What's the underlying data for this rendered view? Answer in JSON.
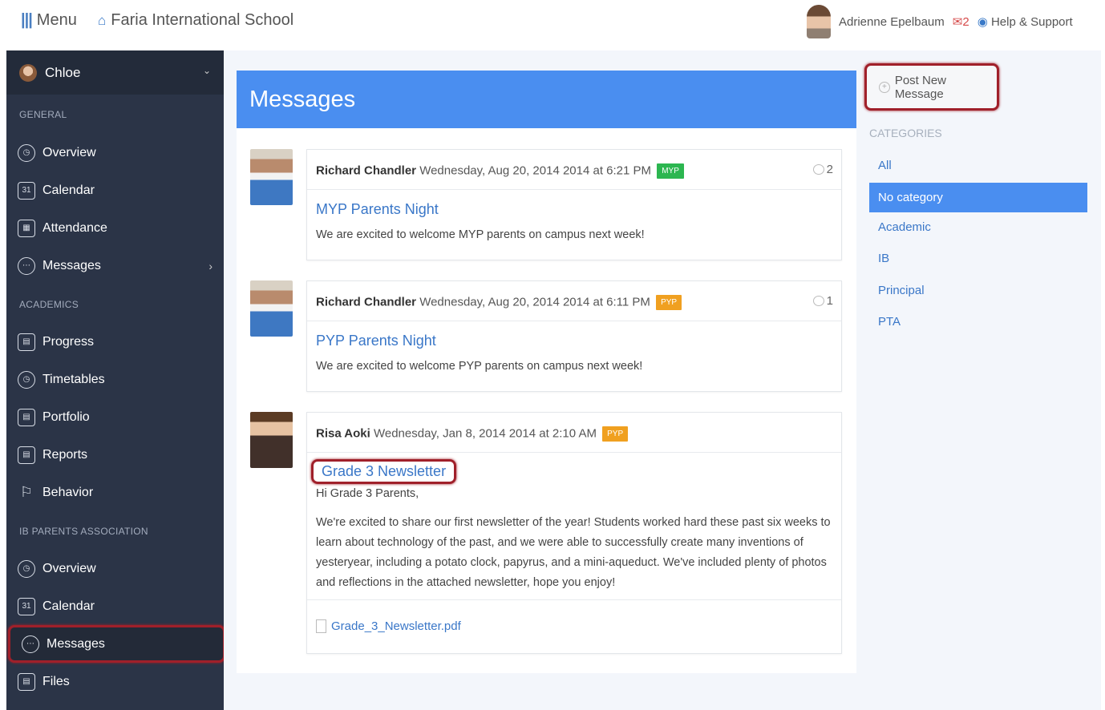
{
  "topbar": {
    "menu_label": "Menu",
    "school_name": "Faria International School",
    "user_name": "Adrienne Epelbaum",
    "mail_count": "2",
    "help_label": "Help & Support"
  },
  "sidebar": {
    "user": "Chloe",
    "sections": [
      {
        "title": "GENERAL",
        "items": [
          {
            "label": "Overview",
            "icon": "clock-icon"
          },
          {
            "label": "Calendar",
            "icon": "calendar-icon"
          },
          {
            "label": "Attendance",
            "icon": "attendance-icon"
          },
          {
            "label": "Messages",
            "icon": "messages-icon",
            "arrow": true
          }
        ]
      },
      {
        "title": "ACADEMICS",
        "items": [
          {
            "label": "Progress",
            "icon": "progress-icon"
          },
          {
            "label": "Timetables",
            "icon": "clock-icon"
          },
          {
            "label": "Portfolio",
            "icon": "portfolio-icon"
          },
          {
            "label": "Reports",
            "icon": "reports-icon"
          },
          {
            "label": "Behavior",
            "icon": "flag-icon"
          }
        ]
      },
      {
        "title": "IB PARENTS ASSOCIATION",
        "items": [
          {
            "label": "Overview",
            "icon": "clock-icon"
          },
          {
            "label": "Calendar",
            "icon": "calendar-icon"
          },
          {
            "label": "Messages",
            "icon": "messages-icon",
            "active": true
          },
          {
            "label": "Files",
            "icon": "files-icon"
          }
        ]
      }
    ]
  },
  "messages_panel": {
    "header": "Messages",
    "messages": [
      {
        "author": "Richard Chandler",
        "date": "Wednesday, Aug 20, 2014 2014 at 6:21 PM",
        "badge": "MYP",
        "comments": "2",
        "title": "MYP Parents Night",
        "body": "We are excited to welcome MYP parents on campus next week!"
      },
      {
        "author": "Richard Chandler",
        "date": "Wednesday, Aug 20, 2014 2014 at 6:11 PM",
        "badge": "PYP",
        "comments": "1",
        "title": "PYP Parents Night",
        "body": "We are excited to welcome PYP parents on campus next week!"
      },
      {
        "author": "Risa Aoki",
        "date": "Wednesday, Jan 8, 2014 2014 at 2:10 AM",
        "badge": "PYP",
        "title": "Grade 3 Newsletter",
        "greeting": "Hi Grade 3 Parents,",
        "body": "We're excited to share our first newsletter of the year! Students worked hard these past six weeks to learn about technology of the past, and we were able to successfully create many inventions of yesteryear, including a potato clock, papyrus, and a mini-aqueduct. We've included plenty of photos and reflections in the attached newsletter, hope you enjoy!",
        "attachment": "Grade_3_Newsletter.pdf"
      }
    ]
  },
  "right": {
    "post_label": "Post New Message",
    "categories_title": "CATEGORIES",
    "categories": [
      "All",
      "No category",
      "Academic",
      "IB",
      "Principal",
      "PTA"
    ],
    "active_category": "No category"
  },
  "colors": {
    "accent": "#4a8ef0",
    "sidebar": "#2b3447",
    "highlight": "#a0202a",
    "myp_badge": "#2cb650",
    "pyp_badge": "#f0a020"
  }
}
